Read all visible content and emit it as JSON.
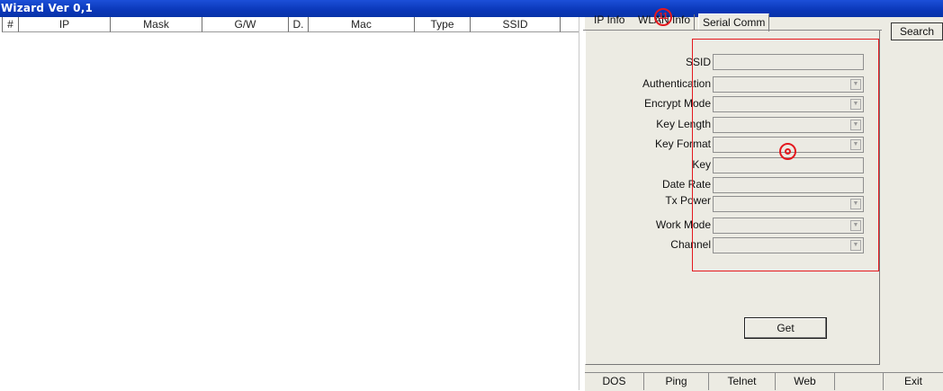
{
  "title_bar": {
    "title": "Wizard Ver 0,1"
  },
  "list": {
    "columns": [
      "#",
      "IP",
      "Mask",
      "G/W",
      "D.",
      "Mac",
      "Type",
      "SSID"
    ]
  },
  "tabs": [
    {
      "label": "IP Info"
    },
    {
      "label": "WLAN Info"
    },
    {
      "label": "Serial Comm"
    }
  ],
  "search_button": "Search",
  "form": {
    "ssid": "SSID",
    "authentication": "Authentication",
    "encrypt_mode": "Encrypt Mode",
    "key_length": "Key Length",
    "key_format": "Key Format",
    "key": "Key",
    "date_rate": "Date Rate",
    "tx_power": "Tx Power",
    "work_mode": "Work Mode",
    "channel": "Channel"
  },
  "get_button": "Get",
  "bottom_buttons": {
    "dos": "DOS",
    "ping": "Ping",
    "telnet": "Telnet",
    "web": "Web",
    "exit": "Exit"
  },
  "annotations": {
    "badge_11": "11",
    "accent_color": "#e4181e"
  }
}
